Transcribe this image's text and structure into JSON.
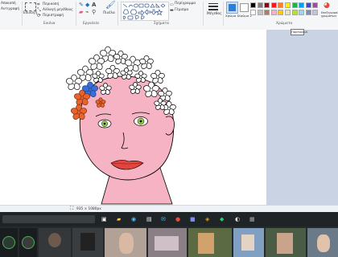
{
  "ribbon": {
    "clipboard": {
      "items": [
        "Αποκοπή",
        "Αντιγραφή"
      ]
    },
    "image": {
      "select_label": "Επιλογή",
      "crop_label": "Περικοπή",
      "resize_label": "Αλλαγή μεγέθους",
      "rotate_label": "Περιστροφή",
      "title": "Εικόνα"
    },
    "tools": {
      "brushes_label": "Πινέλα",
      "title": "Εργαλεία"
    },
    "shapes": {
      "outline_label": "Περίγραμμα",
      "fill_label": "Γέμισμα",
      "title": "Σχήματα"
    },
    "size": {
      "label": "Μέγεθος"
    },
    "colors": {
      "color1_label": "Χρώμα 1",
      "color2_label": "Χρώμα 2",
      "edit_label": "Επεξεργασία χρωμάτων",
      "title": "Χρώματα",
      "tooltip": "Πορτοκαλί",
      "color1": "#2d7fd6",
      "color2": "#ffffff",
      "palette_row1": [
        "#000000",
        "#7f7f7f",
        "#880015",
        "#ed1c24",
        "#ff7f27",
        "#fff200",
        "#22b14c",
        "#00a2e8",
        "#3f48cc",
        "#a349a4"
      ],
      "palette_row2": [
        "#ffffff",
        "#c3c3c3",
        "#b97a57",
        "#ffaec9",
        "#ffc90e",
        "#efe4b0",
        "#b5e61d",
        "#99d9ea",
        "#7092be",
        "#c8bfe7"
      ]
    }
  },
  "status": {
    "dimensions": "935 × 1080px"
  },
  "drawing": {
    "skin": "#f5b3c3",
    "lips": "#e2453e",
    "eye": "#9acd4a",
    "flower_orange": "#e9642c",
    "flower_blue": "#3a6fd8"
  }
}
